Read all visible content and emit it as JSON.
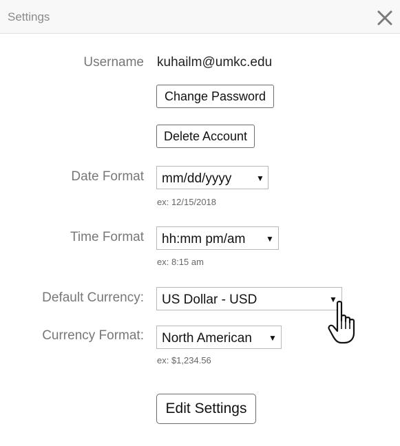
{
  "dialog": {
    "title": "Settings",
    "close_icon": "close-icon"
  },
  "username": {
    "label": "Username",
    "value": "kuhailm@umkc.edu"
  },
  "buttons": {
    "change_password": "Change Password",
    "delete_account": "Delete Account",
    "edit_settings": "Edit Settings"
  },
  "date_format": {
    "label": "Date Format",
    "selected": "mm/dd/yyyy",
    "example": "ex: 12/15/2018"
  },
  "time_format": {
    "label": "Time Format",
    "selected": "hh:mm pm/am",
    "example": "ex: 8:15 am"
  },
  "default_currency": {
    "label": "Default Currency:",
    "selected": "US Dollar - USD"
  },
  "currency_format": {
    "label": "Currency Format:",
    "selected": "North American",
    "example": "ex: $1,234.56"
  },
  "dropdown_arrow": "▼",
  "cursor_icon": "hand-pointer-icon"
}
